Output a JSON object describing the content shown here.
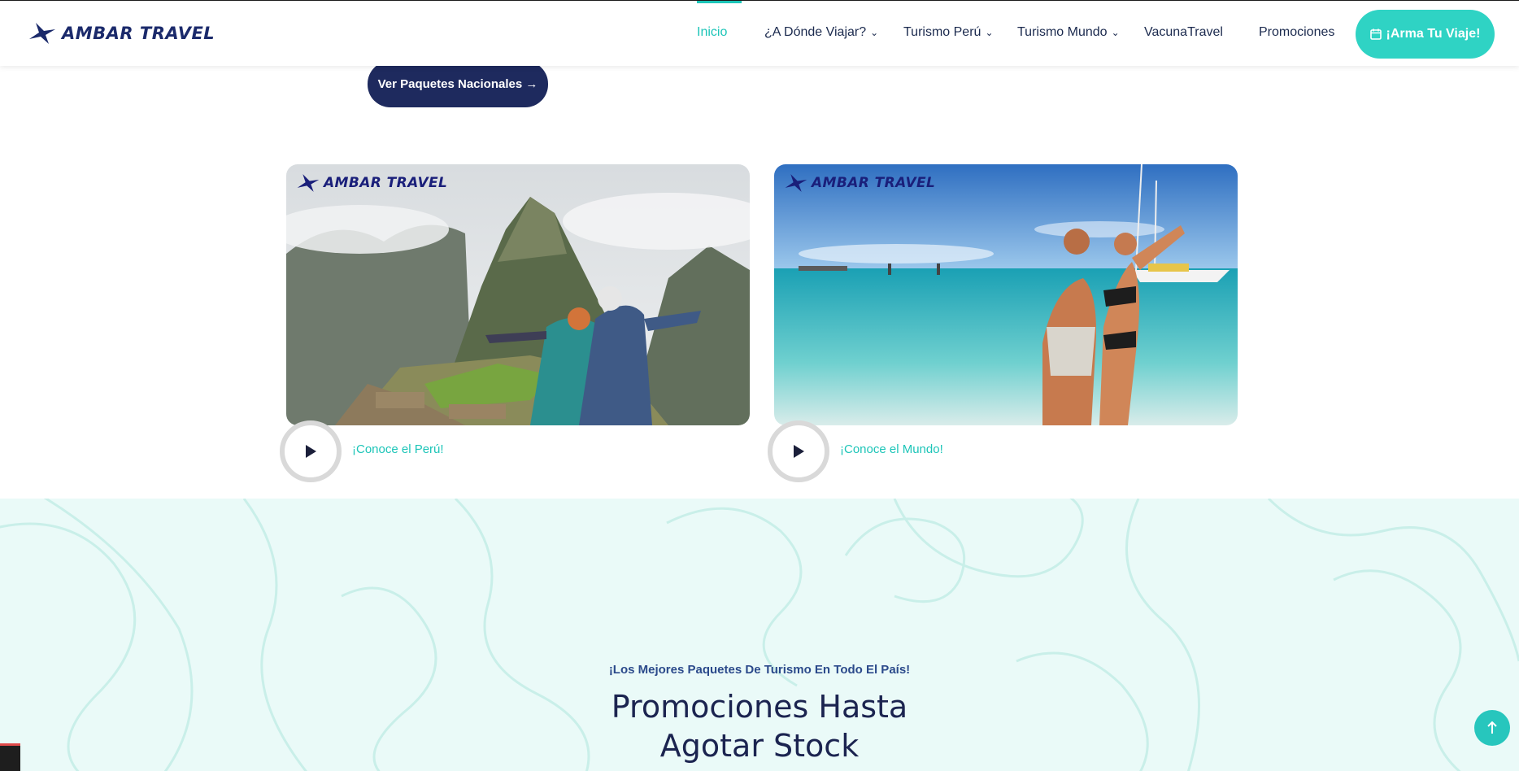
{
  "header": {
    "brand": "AMBAR TRAVEL",
    "nav": [
      {
        "label": "Inicio",
        "active": true
      },
      {
        "label": "¿A Dónde Viajar?",
        "dropdown": true
      },
      {
        "label": "Turismo Perú",
        "dropdown": true
      },
      {
        "label": "Turismo Mundo",
        "dropdown": true
      },
      {
        "label": "VacunaTravel"
      },
      {
        "label": "Promociones"
      }
    ],
    "cta_label": "¡Arma Tu Viaje!",
    "cta_icon": "calendar-icon"
  },
  "hero": {
    "button_label": "Ver Paquetes Nacionales →"
  },
  "cards": [
    {
      "brand": "AMBAR TRAVEL",
      "label": "¡Conoce el Perú!",
      "icon": "play-icon"
    },
    {
      "brand": "AMBAR TRAVEL",
      "label": "¡Conoce el Mundo!",
      "icon": "play-icon"
    }
  ],
  "promo": {
    "subtitle": "¡Los Mejores Paquetes De Turismo En Todo El País!",
    "title": "Promociones Hasta Agotar Stock"
  },
  "colors": {
    "accent": "#1dc5b8",
    "navy": "#1e2a5e",
    "promo_bg": "#eafaf8"
  }
}
